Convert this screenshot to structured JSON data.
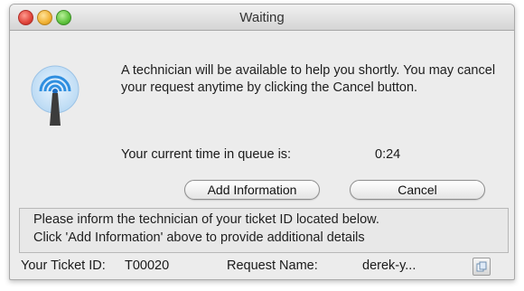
{
  "window": {
    "title": "Waiting"
  },
  "icons": {
    "app": "broadcast-antenna-icon",
    "copy": "copy-icon"
  },
  "message": {
    "text": "A technician will be available to help you shortly. You may cancel your request anytime by clicking the Cancel button."
  },
  "queue": {
    "label": "Your current time in queue is:",
    "value": "0:24"
  },
  "buttons": {
    "add_information": "Add Information",
    "cancel": "Cancel"
  },
  "info_panel": {
    "line1": "Please inform the technician of your ticket ID located below.",
    "line2": "Click 'Add Information' above to provide additional details"
  },
  "footer": {
    "ticket_label": "Your Ticket ID:",
    "ticket_id": "T00020",
    "request_label": "Request Name:",
    "request_name": "derek-y..."
  },
  "colors": {
    "window_bg": "#ececec",
    "antenna_blue": "#2f8fe0"
  }
}
